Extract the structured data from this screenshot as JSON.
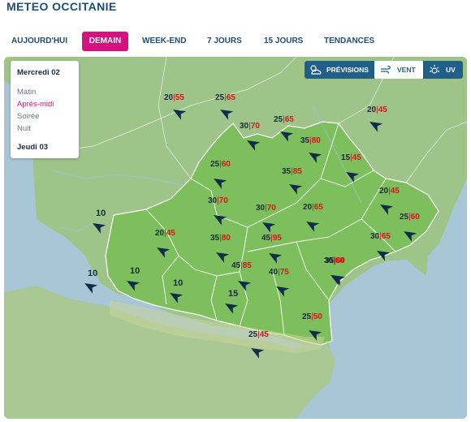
{
  "header": {
    "title": "METEO OCCITANIE"
  },
  "tabs": [
    {
      "label": "AUJOURD'HUI",
      "active": false
    },
    {
      "label": "DEMAIN",
      "active": true
    },
    {
      "label": "WEEK-END",
      "active": false
    },
    {
      "label": "7 JOURS",
      "active": false
    },
    {
      "label": "15 JOURS",
      "active": false
    },
    {
      "label": "TENDANCES",
      "active": false
    }
  ],
  "day_selector": {
    "day1": "Mercredi 02",
    "periods": [
      "Matin",
      "Après-midi",
      "Soirée",
      "Nuit"
    ],
    "selected_period": "Après-midi",
    "day2": "Jeudi 03"
  },
  "layer_toggle": {
    "previsions": "PRÉVISIONS",
    "vent": "VENT",
    "uv": "UV",
    "active": "VENT"
  },
  "colors": {
    "brand": "#1d4e72",
    "accent": "#d4117f",
    "gust": "#d8141a",
    "arrow": "#0f2d4a",
    "sea": "#a8c6d5",
    "region": "#7dbf5c",
    "land": "#9ec48a"
  },
  "wind_points": [
    {
      "speed": "20",
      "gust": "55",
      "dir": 300
    },
    {
      "speed": "25",
      "gust": "65",
      "dir": 300
    },
    {
      "speed": "25",
      "gust": "65",
      "dir": 300
    },
    {
      "speed": "20",
      "gust": "45",
      "dir": 300
    },
    {
      "speed": "30",
      "gust": "70",
      "dir": 300
    },
    {
      "speed": "35",
      "gust": "80",
      "dir": 300
    },
    {
      "speed": "15",
      "gust": "45",
      "dir": 300
    },
    {
      "speed": "25",
      "gust": "60",
      "dir": 300
    },
    {
      "speed": "35",
      "gust": "85",
      "dir": 300
    },
    {
      "speed": "20",
      "gust": "45",
      "dir": 300
    },
    {
      "speed": "30",
      "gust": "70",
      "dir": 300
    },
    {
      "speed": "30",
      "gust": "70",
      "dir": 300
    },
    {
      "speed": "20",
      "gust": "65",
      "dir": 300
    },
    {
      "speed": "25",
      "gust": "60",
      "dir": 300
    },
    {
      "speed": "20",
      "gust": "45",
      "dir": 300
    },
    {
      "speed": "35",
      "gust": "80",
      "dir": 300
    },
    {
      "speed": "45",
      "gust": "95",
      "dir": 300
    },
    {
      "speed": "30",
      "gust": "65",
      "dir": 300
    },
    {
      "speed": "35",
      "gust": "60",
      "dir": 300
    },
    {
      "speed": "45",
      "gust": "85",
      "dir": 300
    },
    {
      "speed": "40",
      "gust": "75",
      "dir": 300
    },
    {
      "speed": "30",
      "gust": "60",
      "dir": 300
    },
    {
      "speed": "25",
      "gust": "50",
      "dir": 300
    },
    {
      "speed": "25",
      "gust": "45",
      "dir": 300
    }
  ],
  "sea_points": [
    {
      "speed": "10",
      "dir": 300
    },
    {
      "speed": "10",
      "dir": 300
    },
    {
      "speed": "10",
      "dir": 300
    },
    {
      "speed": "10",
      "dir": 300
    },
    {
      "speed": "15",
      "dir": 300
    }
  ]
}
